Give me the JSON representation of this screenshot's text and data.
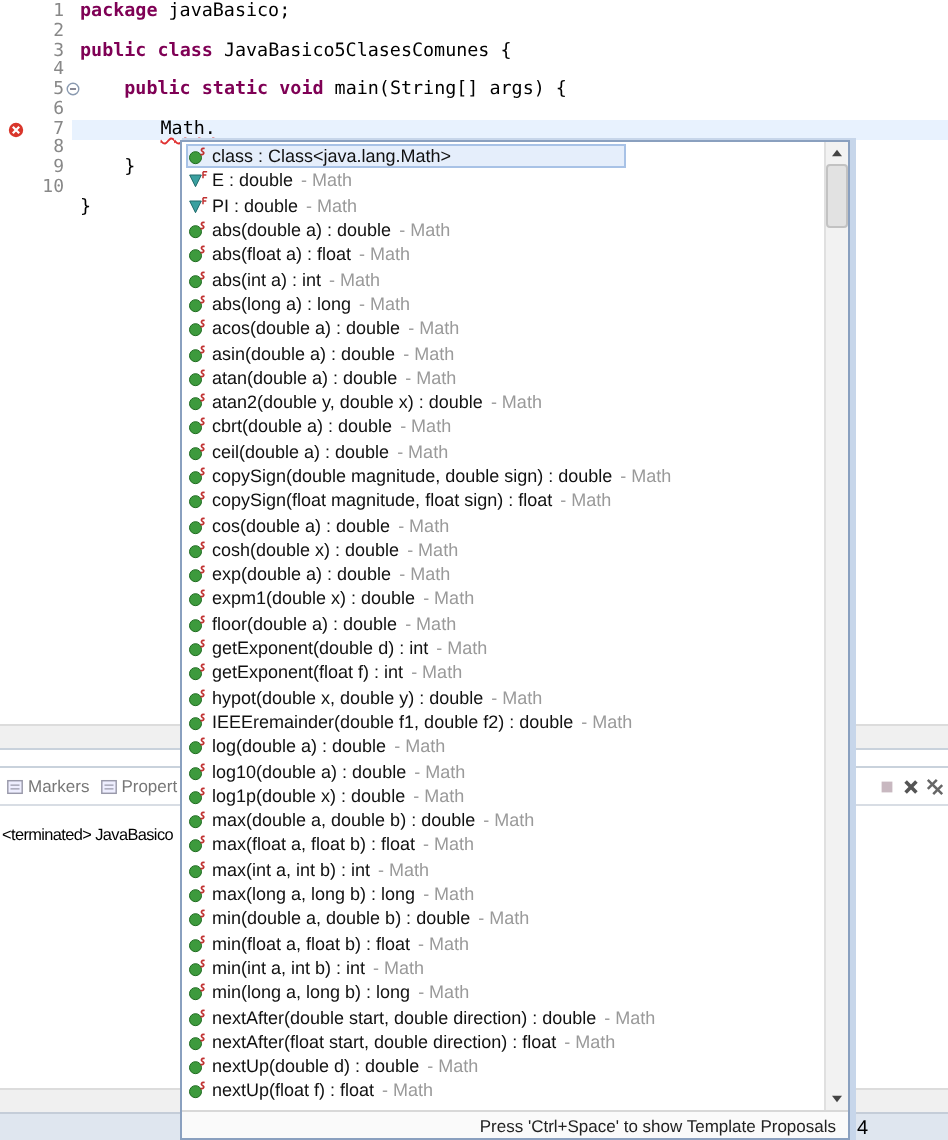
{
  "editor": {
    "lines": [
      {
        "number": "1",
        "text": "**package** javaBasico;"
      },
      {
        "number": "2"
      },
      {
        "number": "3",
        "text": "**public** **class** JavaBasico5ClasesComunes {"
      },
      {
        "number": "4"
      },
      {
        "number": "5",
        "text": "    **public** **static** **void** main(String[] args) {",
        "foldable": true
      },
      {
        "number": "6"
      },
      {
        "number": "7",
        "text": "        Math.",
        "current": true,
        "error": true
      },
      {
        "number": "8"
      },
      {
        "number": "9",
        "text": "    }"
      },
      {
        "number": "10"
      },
      {
        "text": "}"
      }
    ]
  },
  "bottom_panel": {
    "tabs": [
      {
        "label": "Markers",
        "selected": false
      },
      {
        "label": "Propert",
        "selected": false
      }
    ],
    "console_text": "<terminated> JavaBasico"
  },
  "status_bar": {
    "text": "4"
  },
  "completion_popup": {
    "proposals": [
      {
        "kind": "static",
        "label": "class : Class<java.lang.Math>",
        "selected": true
      },
      {
        "kind": "constant",
        "label": "E : double",
        "source": "- Math",
        "selected": false
      },
      {
        "kind": "constant",
        "label": "PI : double",
        "source": "- Math",
        "selected": false
      },
      {
        "kind": "static",
        "label": "abs(double a) : double",
        "source": "- Math",
        "selected": false
      },
      {
        "kind": "static",
        "label": "abs(float a) : float",
        "source": "- Math",
        "selected": false
      },
      {
        "kind": "static",
        "label": "abs(int a) : int",
        "source": "- Math",
        "selected": false
      },
      {
        "kind": "static",
        "label": "abs(long a) : long",
        "source": "- Math",
        "selected": false
      },
      {
        "kind": "static",
        "label": "acos(double a) : double",
        "source": "- Math",
        "selected": false
      },
      {
        "kind": "static",
        "label": "asin(double a) : double",
        "source": "- Math",
        "selected": false
      },
      {
        "kind": "static",
        "label": "atan(double a) : double",
        "source": "- Math",
        "selected": false
      },
      {
        "kind": "static",
        "label": "atan2(double y, double x) : double",
        "source": "- Math",
        "selected": false
      },
      {
        "kind": "static",
        "label": "cbrt(double a) : double",
        "source": "- Math",
        "selected": false
      },
      {
        "kind": "static",
        "label": "ceil(double a) : double",
        "source": "- Math",
        "selected": false
      },
      {
        "kind": "static",
        "label": "copySign(double magnitude, double sign) : double",
        "source": "- Math",
        "selected": false
      },
      {
        "kind": "static",
        "label": "copySign(float magnitude, float sign) : float",
        "source": "- Math",
        "selected": false
      },
      {
        "kind": "static",
        "label": "cos(double a) : double",
        "source": "- Math",
        "selected": false
      },
      {
        "kind": "static",
        "label": "cosh(double x) : double",
        "source": "- Math",
        "selected": false
      },
      {
        "kind": "static",
        "label": "exp(double a) : double",
        "source": "- Math",
        "selected": false
      },
      {
        "kind": "static",
        "label": "expm1(double x) : double",
        "source": "- Math",
        "selected": false
      },
      {
        "kind": "static",
        "label": "floor(double a) : double",
        "source": "- Math",
        "selected": false
      },
      {
        "kind": "static",
        "label": "getExponent(double d) : int",
        "source": "- Math",
        "selected": false
      },
      {
        "kind": "static",
        "label": "getExponent(float f) : int",
        "source": "- Math",
        "selected": false
      },
      {
        "kind": "static",
        "label": "hypot(double x, double y) : double",
        "source": "- Math",
        "selected": false
      },
      {
        "kind": "static",
        "label": "IEEEremainder(double f1, double f2) : double",
        "source": "- Math",
        "selected": false
      },
      {
        "kind": "static",
        "label": "log(double a) : double",
        "source": "- Math",
        "selected": false
      },
      {
        "kind": "static",
        "label": "log10(double a) : double",
        "source": "- Math",
        "selected": false
      },
      {
        "kind": "static",
        "label": "log1p(double x) : double",
        "source": "- Math",
        "selected": false
      },
      {
        "kind": "static",
        "label": "max(double a, double b) : double",
        "source": "- Math",
        "selected": false
      },
      {
        "kind": "static",
        "label": "max(float a, float b) : float",
        "source": "- Math",
        "selected": false
      },
      {
        "kind": "static",
        "label": "max(int a, int b) : int",
        "source": "- Math",
        "selected": false
      },
      {
        "kind": "static",
        "label": "max(long a, long b) : long",
        "source": "- Math",
        "selected": false
      },
      {
        "kind": "static",
        "label": "min(double a, double b) : double",
        "source": "- Math",
        "selected": false
      },
      {
        "kind": "static",
        "label": "min(float a, float b) : float",
        "source": "- Math",
        "selected": false
      },
      {
        "kind": "static",
        "label": "min(int a, int b) : int",
        "source": "- Math",
        "selected": false
      },
      {
        "kind": "static",
        "label": "min(long a, long b) : long",
        "source": "- Math",
        "selected": false
      },
      {
        "kind": "static",
        "label": "nextAfter(double start, double direction) : double",
        "source": "- Math",
        "selected": false
      },
      {
        "kind": "static",
        "label": "nextAfter(float start, double direction) : float",
        "source": "- Math",
        "selected": false
      },
      {
        "kind": "static",
        "label": "nextUp(double d) : double",
        "source": "- Math",
        "selected": false
      },
      {
        "kind": "static",
        "label": "nextUp(float f) : float",
        "source": "- Math",
        "selected": false
      }
    ],
    "footer": "Press 'Ctrl+Space' to show Template Proposals"
  }
}
